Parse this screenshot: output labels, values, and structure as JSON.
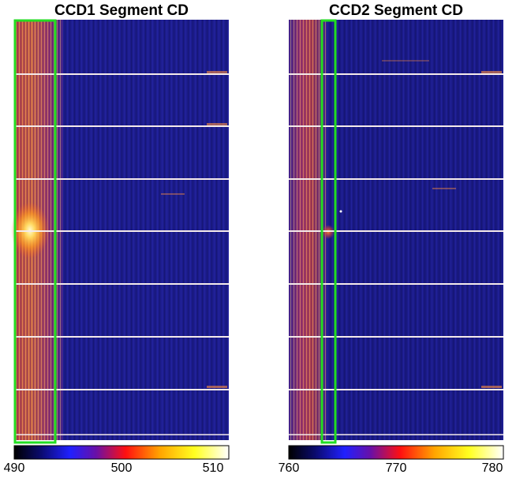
{
  "panels": [
    {
      "title": "CCD1 Segment CD",
      "colorbar_ticks": [
        "490",
        "500",
        "510"
      ]
    },
    {
      "title": "CCD2 Segment CD",
      "colorbar_ticks": [
        "760",
        "770",
        "780"
      ]
    }
  ],
  "colors": {
    "background_field": "#1c1c8c",
    "bright_band": "#e0a040",
    "hot_spot": "#fff0a0",
    "selection_box": "#22dd22",
    "row_lines": "#f8f0f0"
  },
  "colormap": [
    "#000000",
    "#0a0a6a",
    "#2020ff",
    "#7010a0",
    "#ff1010",
    "#ffa500",
    "#ffff20",
    "#ffffff"
  ]
}
